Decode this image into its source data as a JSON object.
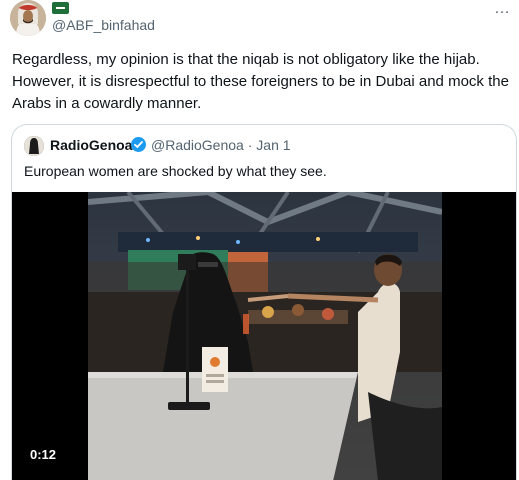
{
  "tweet": {
    "handle": "@ABF_binfahad",
    "more_icon": "…",
    "text": "Regardless, my opinion is that the niqab is not obligatory like the hijab. However, it is disrespectful to these foreigners to be in Dubai and mock the Arabs in a cowardly manner."
  },
  "quote": {
    "name": "RadioGenoa",
    "handle": "@RadioGenoa",
    "separator": "·",
    "date": "Jan 1",
    "text": "European women are shocked by what they see.",
    "video": {
      "duration": "0:12"
    }
  },
  "colors": {
    "verified": "#1d9bf0",
    "secondary_text": "#536471",
    "border": "#cfd9de"
  }
}
